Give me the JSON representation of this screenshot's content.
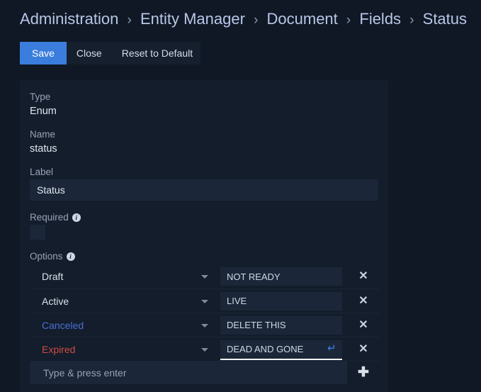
{
  "breadcrumb": {
    "separator": "›",
    "items": [
      {
        "label": "Administration"
      },
      {
        "label": "Entity Manager"
      },
      {
        "label": "Document"
      },
      {
        "label": "Fields"
      },
      {
        "label": "Status"
      }
    ]
  },
  "toolbar": {
    "save_label": "Save",
    "close_label": "Close",
    "reset_label": "Reset to Default"
  },
  "form": {
    "type_label": "Type",
    "type_value": "Enum",
    "name_label": "Name",
    "name_value": "status",
    "label_label": "Label",
    "label_value": "Status",
    "required_label": "Required",
    "required_info_icon": "info-icon",
    "required_checked": false,
    "options_label": "Options",
    "options_info_icon": "info-icon"
  },
  "options": {
    "rows": [
      {
        "name": "Draft",
        "name_color": "#dbe1ec",
        "value": "NOT READY",
        "focused": false,
        "enter_icon": ""
      },
      {
        "name": "Active",
        "name_color": "#dbe1ec",
        "value": "LIVE",
        "focused": false,
        "enter_icon": ""
      },
      {
        "name": "Canceled",
        "name_color": "#4a6fd4",
        "value": "DELETE THIS",
        "focused": false,
        "enter_icon": ""
      },
      {
        "name": "Expired",
        "name_color": "#d04b45",
        "value": "DEAD AND GONE",
        "focused": true,
        "enter_icon": "↵"
      }
    ],
    "caret_icon": "chevron-down-icon",
    "delete_icon": "✕",
    "add_icon": "✚",
    "new_placeholder": "Type & press enter",
    "new_value": ""
  },
  "colors": {
    "page_bg": "#0f1824",
    "panel_bg": "#131d2b",
    "input_bg": "#1b2738",
    "accent": "#3b7ddd",
    "breadcrumb": "#b9c6e8",
    "canceled": "#4a6fd4",
    "expired": "#d04b45",
    "enter_arrow": "#3b82e8"
  }
}
